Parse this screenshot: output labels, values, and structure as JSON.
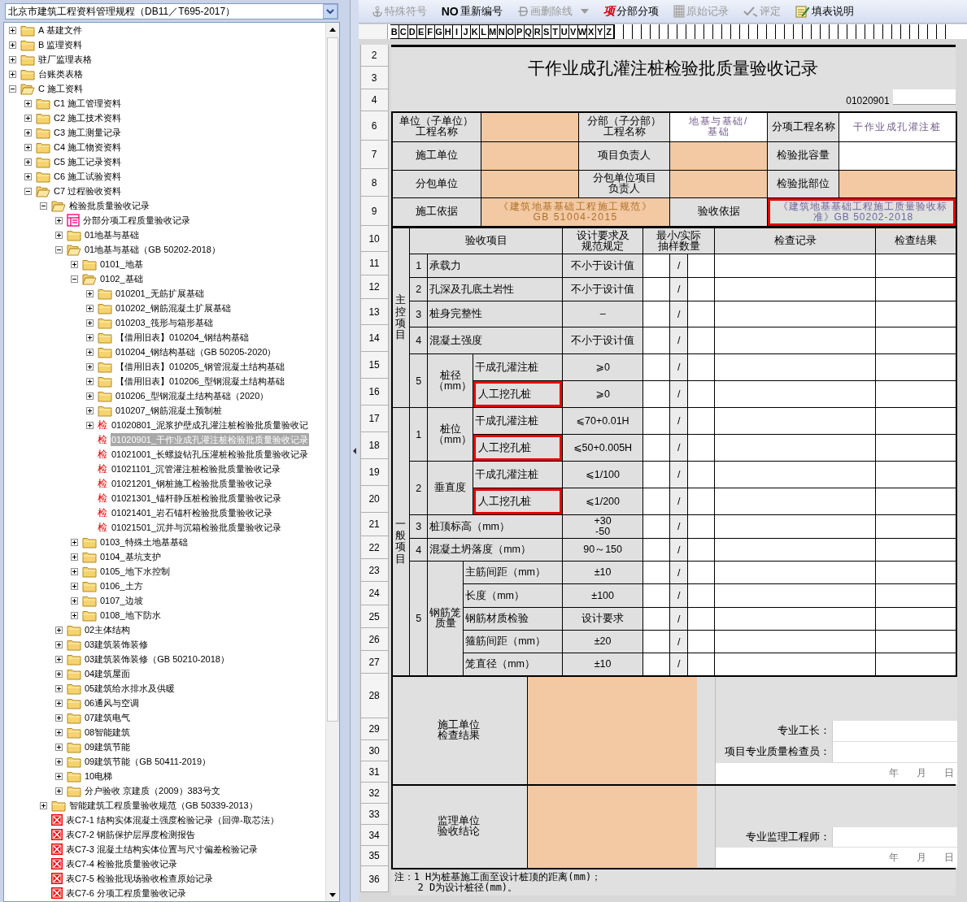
{
  "left_panel": {
    "dropdown": {
      "value": "北京市建筑工程资料管理规程（DB11／T695-2017）"
    },
    "tree": [
      {
        "kind": "folder",
        "label": "A 基建文件",
        "expanded": false,
        "selected": false
      },
      {
        "kind": "folder",
        "label": "B 监理资料",
        "expanded": false,
        "selected": false
      },
      {
        "kind": "folder",
        "label": "驻厂监理表格",
        "expanded": false,
        "selected": false
      },
      {
        "kind": "folder",
        "label": "台账类表格",
        "expanded": false,
        "selected": false
      },
      {
        "kind": "folder",
        "label": "C 施工资料",
        "expanded": true,
        "selected": false,
        "children": [
          {
            "kind": "folder",
            "label": "C1 施工管理资料",
            "expanded": false,
            "selected": false
          },
          {
            "kind": "folder",
            "label": "C2 施工技术资料",
            "expanded": false,
            "selected": false
          },
          {
            "kind": "folder",
            "label": "C3 施工测量记录",
            "expanded": false,
            "selected": false
          },
          {
            "kind": "folder",
            "label": "C4 施工物资资料",
            "expanded": false,
            "selected": false
          },
          {
            "kind": "folder",
            "label": "C5 施工记录资料",
            "expanded": false,
            "selected": false
          },
          {
            "kind": "folder",
            "label": "C6 施工试验资料",
            "expanded": false,
            "selected": false
          },
          {
            "kind": "folder",
            "label": "C7 过程验收资料",
            "expanded": true,
            "selected": false,
            "children": [
              {
                "kind": "folder",
                "label": "检验批质量验收记录",
                "expanded": true,
                "selected": false,
                "children": [
                  {
                    "kind": "form",
                    "label": "分部分项工程质量验收记录",
                    "expanded": false,
                    "selected": false
                  },
                  {
                    "kind": "folder",
                    "label": "01地基与基础",
                    "expanded": false,
                    "selected": false
                  },
                  {
                    "kind": "folder",
                    "label": "01地基与基础（GB 50202-2018）",
                    "expanded": true,
                    "selected": false,
                    "children": [
                      {
                        "kind": "folder",
                        "label": "0101_地基",
                        "expanded": false,
                        "selected": false
                      },
                      {
                        "kind": "folder",
                        "label": "0102_基础",
                        "expanded": true,
                        "selected": false,
                        "children": [
                          {
                            "kind": "folder",
                            "label": "010201_无筋扩展基础",
                            "expanded": false,
                            "selected": false
                          },
                          {
                            "kind": "folder",
                            "label": "010202_钢筋混凝土扩展基础",
                            "expanded": false,
                            "selected": false
                          },
                          {
                            "kind": "folder",
                            "label": "010203_筏形与箱形基础",
                            "expanded": false,
                            "selected": false
                          },
                          {
                            "kind": "folder",
                            "label": "【借用旧表】010204_钢结构基础",
                            "expanded": false,
                            "selected": false
                          },
                          {
                            "kind": "folder",
                            "label": "010204_钢结构基础（GB 50205-2020）",
                            "expanded": false,
                            "selected": false
                          },
                          {
                            "kind": "folder",
                            "label": "【借用旧表】010205_钢管混凝土结构基础",
                            "expanded": false,
                            "selected": false
                          },
                          {
                            "kind": "folder",
                            "label": "【借用旧表】010206_型钢混凝土结构基础",
                            "expanded": false,
                            "selected": false
                          },
                          {
                            "kind": "folder",
                            "label": "010206_型钢混凝土结构基础（2020）",
                            "expanded": false,
                            "selected": false
                          },
                          {
                            "kind": "folder",
                            "label": "010207_钢筋混凝土预制桩",
                            "expanded": false,
                            "selected": false
                          },
                          {
                            "kind": "check",
                            "mark": "检",
                            "label": "01020801_泥浆护壁成孔灌注桩检验批质量验收记",
                            "expanded": false,
                            "selected": false
                          },
                          {
                            "kind": "check",
                            "mark": "检",
                            "label": "01020901_干作业成孔灌注桩检验批质量验收记录",
                            "selected": true
                          },
                          {
                            "kind": "check",
                            "mark": "检",
                            "label": "01021001_长螺旋钻孔压灌桩检验批质量验收记录",
                            "selected": false
                          },
                          {
                            "kind": "check",
                            "mark": "检",
                            "label": "01021101_沉管灌注桩检验批质量验收记录",
                            "selected": false
                          },
                          {
                            "kind": "check",
                            "mark": "检",
                            "label": "01021201_钢桩施工检验批质量验收记录",
                            "selected": false
                          },
                          {
                            "kind": "check",
                            "mark": "检",
                            "label": "01021301_锚杆静压桩检验批质量验收记录",
                            "selected": false
                          },
                          {
                            "kind": "check",
                            "mark": "检",
                            "label": "01021401_岩石锚杆检验批质量验收记录",
                            "selected": false
                          },
                          {
                            "kind": "check",
                            "mark": "检",
                            "label": "01021501_沉井与沉箱检验批质量验收记录",
                            "selected": false
                          }
                        ]
                      },
                      {
                        "kind": "folder",
                        "label": "0103_特殊土地基基础",
                        "expanded": false,
                        "selected": false
                      },
                      {
                        "kind": "folder",
                        "label": "0104_基坑支护",
                        "expanded": false,
                        "selected": false
                      },
                      {
                        "kind": "folder",
                        "label": "0105_地下水控制",
                        "expanded": false,
                        "selected": false
                      },
                      {
                        "kind": "folder",
                        "label": "0106_土方",
                        "expanded": false,
                        "selected": false
                      },
                      {
                        "kind": "folder",
                        "label": "0107_边坡",
                        "expanded": false,
                        "selected": false
                      },
                      {
                        "kind": "folder",
                        "label": "0108_地下防水",
                        "expanded": false,
                        "selected": false
                      }
                    ]
                  },
                  {
                    "kind": "folder",
                    "label": "02主体结构",
                    "expanded": false,
                    "selected": false
                  },
                  {
                    "kind": "folder",
                    "label": "03建筑装饰装修",
                    "expanded": false,
                    "selected": false
                  },
                  {
                    "kind": "folder",
                    "label": "03建筑装饰装修（GB 50210-2018）",
                    "expanded": false,
                    "selected": false
                  },
                  {
                    "kind": "folder",
                    "label": "04建筑屋面",
                    "expanded": false,
                    "selected": false
                  },
                  {
                    "kind": "folder",
                    "label": "05建筑给水排水及供暖",
                    "expanded": false,
                    "selected": false
                  },
                  {
                    "kind": "folder",
                    "label": "06通风与空调",
                    "expanded": false,
                    "selected": false
                  },
                  {
                    "kind": "folder",
                    "label": "07建筑电气",
                    "expanded": false,
                    "selected": false
                  },
                  {
                    "kind": "folder",
                    "label": "08智能建筑",
                    "expanded": false,
                    "selected": false
                  },
                  {
                    "kind": "folder",
                    "label": "09建筑节能",
                    "expanded": false,
                    "selected": false
                  },
                  {
                    "kind": "folder",
                    "label": "09建筑节能（GB 50411-2019）",
                    "expanded": false,
                    "selected": false
                  },
                  {
                    "kind": "folder",
                    "label": "10电梯",
                    "expanded": false,
                    "selected": false
                  },
                  {
                    "kind": "folder",
                    "label": "分户验收 京建质（2009）383号文",
                    "expanded": false,
                    "selected": false
                  }
                ]
              },
              {
                "kind": "folder",
                "label": "智能建筑工程质量验收规范（GB 50339-2013）",
                "expanded": false,
                "selected": false
              },
              {
                "kind": "report",
                "label": "表C7-1 结构实体混凝土强度检验记录（回弹-取芯法）",
                "selected": false
              },
              {
                "kind": "report",
                "label": "表C7-2 钢筋保护层厚度检测报告",
                "selected": false
              },
              {
                "kind": "report",
                "label": "表C7-3 混凝土结构实体位置与尺寸偏差检验记录",
                "selected": false
              },
              {
                "kind": "report",
                "label": "表C7-4 检验批质量验收记录",
                "selected": false
              },
              {
                "kind": "report",
                "label": "表C7-5 检验批现场验收检查原始记录",
                "selected": false
              },
              {
                "kind": "report",
                "label": "表C7-6 分项工程质量验收记录",
                "selected": false
              }
            ]
          }
        ]
      }
    ]
  },
  "toolbar": [
    {
      "kind": "symbol",
      "label": "特殊符号",
      "disabled": true
    },
    {
      "kind": "renumber",
      "icon_text": "NO",
      "label": "重新编号",
      "disabled": false
    },
    {
      "kind": "strike",
      "label": "画删除线",
      "disabled": true
    },
    {
      "kind": "section",
      "icon_text": "项",
      "label": "分部分项",
      "disabled": false
    },
    {
      "kind": "record",
      "label": "原始记录",
      "disabled": true
    },
    {
      "kind": "rate",
      "label": "评定",
      "disabled": true
    },
    {
      "kind": "help",
      "label": "填表说明",
      "disabled": false
    }
  ],
  "sheet": {
    "column_letters": [
      "B",
      "C",
      "D",
      "E",
      "F",
      "G",
      "H",
      "I",
      "J",
      "K",
      "L",
      "M",
      "N",
      "O",
      "P",
      "Q",
      "R",
      "S",
      "T",
      "U",
      "V",
      "W",
      "X",
      "Y",
      "Z"
    ],
    "row_numbers": [
      "2",
      "3",
      "4",
      "6",
      "7",
      "8",
      "9",
      "10",
      "11",
      "12",
      "13",
      "14",
      "15",
      "16",
      "17",
      "18",
      "19",
      "20",
      "21",
      "22",
      "23",
      "24",
      "25",
      "26",
      "27",
      "28",
      "29",
      "30",
      "31",
      "32",
      "33",
      "34",
      "35",
      "36"
    ],
    "title": "干作业成孔灌注桩检验批质量验收记录",
    "form_code": "01020901",
    "info_rows": [
      [
        {
          "label": "单位（子单位）工程名称",
          "cell": {
            "kind": "input",
            "highlighted": false
          }
        },
        {
          "label": "分部（子分部）工程名称",
          "cell": {
            "kind": "fixed",
            "value": "地基与基础/基础",
            "highlighted": false
          }
        },
        {
          "label": "分项工程名称",
          "cell": {
            "kind": "fixed",
            "value": "干作业成孔灌注桩",
            "highlighted": false
          }
        }
      ],
      [
        {
          "label": "施工单位",
          "cell": {
            "kind": "input",
            "highlighted": false
          }
        },
        {
          "label": "项目负责人",
          "cell": {
            "kind": "input",
            "highlighted": false
          }
        },
        {
          "label": "检验批容量",
          "cell": {
            "kind": "fixed",
            "highlighted": false
          }
        }
      ],
      [
        {
          "label": "分包单位",
          "cell": {
            "kind": "input",
            "highlighted": false
          }
        },
        {
          "label": "分包单位项目负责人",
          "cell": {
            "kind": "input",
            "highlighted": false
          }
        },
        {
          "label": "检验批部位",
          "cell": {
            "kind": "input",
            "highlighted": false
          }
        }
      ],
      [
        {
          "label": "施工依据",
          "cell": {
            "kind": "input",
            "value": "《建筑地基基础工程施工规范》\nGB 51004-2015",
            "highlighted": false
          }
        },
        {
          "label": "验收依据",
          "cell": {
            "kind": "reference",
            "value": "《建筑地基基础工程施工质量验收标准》GB 50202-2018",
            "highlighted": true
          }
        }
      ]
    ],
    "inspection": {
      "headers": {
        "item": "验收项目",
        "requirement": "设计要求及规范规定",
        "sample": "最小/实际抽样数量",
        "record": "检查记录",
        "result": "检查结果"
      },
      "groups": [
        {
          "name": "主控项目",
          "items": [
            {
              "kind": "single",
              "no": "1",
              "name": "承载力",
              "requirement": "不小于设计值",
              "sample": "/"
            },
            {
              "kind": "single",
              "no": "2",
              "name": "孔深及孔底土岩性",
              "requirement": "不小于设计值",
              "sample": "/"
            },
            {
              "kind": "single",
              "no": "3",
              "name": "桩身完整性",
              "requirement": "–",
              "sample": "/"
            },
            {
              "kind": "single",
              "no": "4",
              "name": "混凝土强度",
              "requirement": "不小于设计值",
              "sample": "/"
            },
            {
              "kind": "split",
              "no": "5",
              "name": "桩径（mm）",
              "subitems": [
                {
                  "name": "干成孔灌注桩",
                  "requirement": "⩾0",
                  "sample": "/",
                  "highlighted": false
                },
                {
                  "name": "人工挖孔桩",
                  "requirement": "⩾0",
                  "sample": "/",
                  "highlighted": true
                }
              ]
            }
          ]
        },
        {
          "name": "一般项目",
          "items": [
            {
              "kind": "split",
              "no": "1",
              "name": "桩位（mm）",
              "subitems": [
                {
                  "name": "干成孔灌注桩",
                  "requirement": "⩽70+0.01H",
                  "sample": "/",
                  "highlighted": false
                },
                {
                  "name": "人工挖孔桩",
                  "requirement": "⩽50+0.005H",
                  "sample": "/",
                  "highlighted": true
                }
              ]
            },
            {
              "kind": "split",
              "no": "2",
              "name": "垂直度",
              "subitems": [
                {
                  "name": "干成孔灌注桩",
                  "requirement": "⩽1/100",
                  "sample": "/",
                  "highlighted": false
                },
                {
                  "name": "人工挖孔桩",
                  "requirement": "⩽1/200",
                  "sample": "/",
                  "highlighted": true
                }
              ]
            },
            {
              "kind": "single",
              "no": "3",
              "name": "桩顶标高（mm）",
              "requirement": "+30\n-50",
              "sample": "/"
            },
            {
              "kind": "single",
              "no": "4",
              "name": "混凝土坍落度（mm）",
              "requirement": "90～150",
              "sample": "/"
            },
            {
              "kind": "group",
              "no": "5",
              "name": "钢筋笼质量",
              "subitems": [
                {
                  "name": "主筋间距（mm）",
                  "requirement": "±10",
                  "sample": "/",
                  "highlighted": false
                },
                {
                  "name": "长度（mm）",
                  "requirement": "±100",
                  "sample": "/",
                  "highlighted": false
                },
                {
                  "name": "钢筋材质检验",
                  "requirement": "设计要求",
                  "sample": "/",
                  "highlighted": false
                },
                {
                  "name": "箍筋间距（mm）",
                  "requirement": "±20",
                  "sample": "/",
                  "highlighted": false
                },
                {
                  "name": "笼直径（mm）",
                  "requirement": "±10",
                  "sample": "/",
                  "highlighted": false
                }
              ]
            }
          ]
        }
      ]
    },
    "sign_off": [
      {
        "label": "施工单位检查结果",
        "signers": [
          "专业工长：",
          "项目专业质量检查员："
        ],
        "date": [
          "年",
          "月",
          "日"
        ]
      },
      {
        "label": "监理单位验收结论",
        "signers": [
          "专业监理工程师："
        ],
        "date": [
          "年",
          "月",
          "日"
        ]
      }
    ],
    "note": "注：1 H为桩基施工面至设计桩顶的距离(mm)；\n    2 D为设计桩径(mm)。"
  }
}
